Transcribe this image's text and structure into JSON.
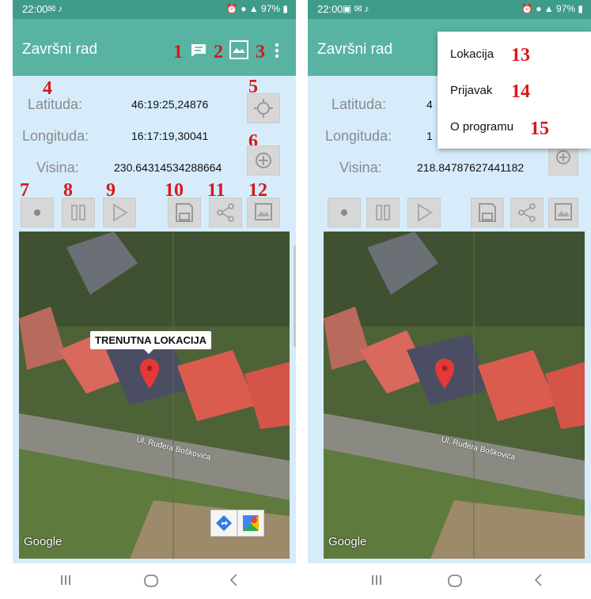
{
  "status_bar": {
    "time": "22:00",
    "battery": "97%"
  },
  "app": {
    "title": "Završni rad"
  },
  "annotations": [
    "1",
    "2",
    "3",
    "4",
    "5",
    "6",
    "7",
    "8",
    "9",
    "10",
    "11",
    "12",
    "13",
    "14",
    "15"
  ],
  "left_screen": {
    "latitude": {
      "label": "Latituda:",
      "value": "46:19:25,24876"
    },
    "longitude": {
      "label": "Longituda:",
      "value": "16:17:19,30041"
    },
    "altitude": {
      "label": "Visina:",
      "value": "230.64314534288664"
    },
    "map": {
      "marker_callout": "TRENUTNA LOKACIJA",
      "street_label": "Ul. Ruđera Boškovića",
      "attribution": "Google"
    }
  },
  "right_screen": {
    "latitude": {
      "label": "Latituda:",
      "value": "4"
    },
    "longitude": {
      "label": "Longituda:",
      "value": "1"
    },
    "altitude": {
      "label": "Visina:",
      "value": "218.84787627441182"
    },
    "map": {
      "street_label": "Ul. Ruđera Boškovića",
      "attribution": "Google"
    },
    "overflow_menu": {
      "items": [
        {
          "label": "Lokacija"
        },
        {
          "label": "Prijavak"
        },
        {
          "label": "O programu"
        }
      ]
    }
  },
  "colors": {
    "status_bar": "#3f9b8a",
    "app_bar": "#58b3a3",
    "screen_background": "#d6ecfa",
    "annotation_red": "#d61a1a",
    "button_gray": "#d7d7d7",
    "marker_red": "#e53935"
  },
  "icons": {
    "toolbar": [
      "chat-icon",
      "map-icon",
      "more-vert-icon"
    ],
    "side_buttons": [
      "gps-fix-icon",
      "zoom-in-icon"
    ],
    "controls": [
      "record-icon",
      "pause-icon",
      "play-icon",
      "save-icon",
      "share-icon",
      "map-icon"
    ],
    "map_buttons": [
      "directions-icon",
      "google-maps-icon"
    ],
    "nav": [
      "recents-icon",
      "home-icon",
      "back-icon"
    ]
  }
}
